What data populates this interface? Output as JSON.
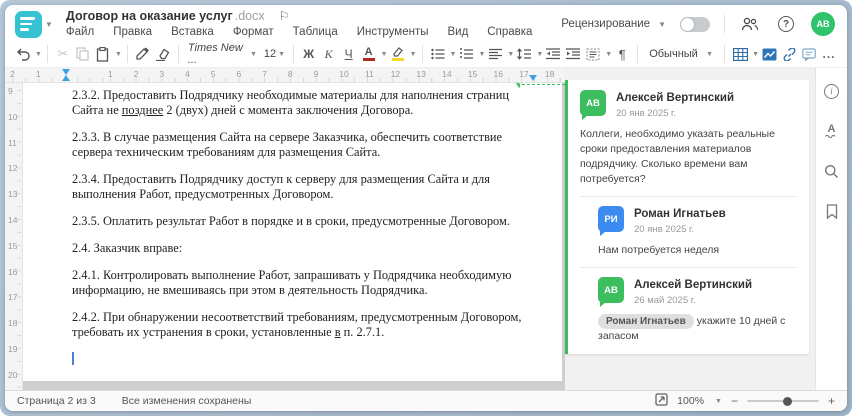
{
  "header": {
    "title": "Договор на оказание услуг",
    "title_ext": ".docx",
    "review_label": "Рецензирование",
    "avatar_initials": "АВ"
  },
  "menu": {
    "items": [
      "Файл",
      "Правка",
      "Вставка",
      "Формат",
      "Таблица",
      "Инструменты",
      "Вид",
      "Справка"
    ]
  },
  "toolbar": {
    "font_name": "Times New ...",
    "font_size": "12",
    "bold": "Ж",
    "italic": "К",
    "underline": "Ч",
    "font_color_letter": "А",
    "pilcrow": "¶",
    "style_name": "Обычный",
    "more": "..."
  },
  "rulers": {
    "h_left": [
      "2",
      "1"
    ],
    "h_numbers": [
      "1",
      "2",
      "3",
      "4",
      "5",
      "6",
      "7",
      "8",
      "9",
      "10",
      "11",
      "12",
      "13",
      "14",
      "15",
      "16",
      "17",
      "18"
    ],
    "v_numbers": [
      "9",
      "10",
      "11",
      "12",
      "13",
      "14",
      "15",
      "16",
      "17",
      "18",
      "19",
      "20"
    ]
  },
  "document": {
    "paragraphs": [
      {
        "pre": "2.3.2. Предоставить Подрядчику необходимые материалы для наполнения страниц Сайта не ",
        "u": "позднее",
        "post": " 2 (двух) дней с момента заключения Договора."
      },
      {
        "pre": "2.3.3. В случае размещения Сайта на сервере Заказчика, обеспечить соответствие сервера техническим требованиям для размещения Сайта."
      },
      {
        "pre": "2.3.4. Предоставить Подрядчику доступ к серверу для размещения Сайта и для выполнения Работ, предусмотренных Договором."
      },
      {
        "pre": "2.3.5. Оплатить результат Работ в порядке и в сроки, предусмотренные Договором."
      },
      {
        "pre": "2.4. Заказчик вправе:",
        "gap_before": true
      },
      {
        "pre": "2.4.1. Контролировать выполнение Работ, запрашивать у Подрядчика необходимую информацию, не вмешиваясь при этом в деятельность Подрядчика."
      },
      {
        "pre": "2.4.2. При обнаружении несоответствий требованиям, предусмотренным Договором, требовать их устранения в сроки, установленные ",
        "u": "в",
        "post": " п. 2.7.1."
      }
    ]
  },
  "comments": {
    "thread": [
      {
        "initials": "АВ",
        "color": "#3cbd5e",
        "name": "Алексей Вертинский",
        "date": "20 янв 2025 г.",
        "text": "Коллеги, необходимо указать реальные сроки предоставления материалов подрядчику. Сколько времени вам потребуется?",
        "reply": false
      },
      {
        "initials": "РИ",
        "color": "#3c8bf0",
        "name": "Роман Игнатьев",
        "date": "20 янв 2025 г.",
        "text": "Нам потребуется неделя",
        "reply": true
      },
      {
        "initials": "АВ",
        "color": "#3cbd5e",
        "name": "Алексей Вертинский",
        "date": "26 май 2025 г.",
        "mention": "Роман Игнатьев",
        "text": "укажите 10 дней с запасом",
        "reply": true
      }
    ]
  },
  "status": {
    "page": "Страница 2 из 3",
    "saved": "Все изменения сохранены",
    "zoom": "100%"
  },
  "colors": {
    "accent_teal": "#35c3d1",
    "comment_green": "#3cbd5e",
    "avatar_green": "#2fc36b",
    "reply_blue": "#3c8bf0",
    "toolbar_blue": "#2d6da3",
    "marker_blue": "#3da0e3"
  }
}
